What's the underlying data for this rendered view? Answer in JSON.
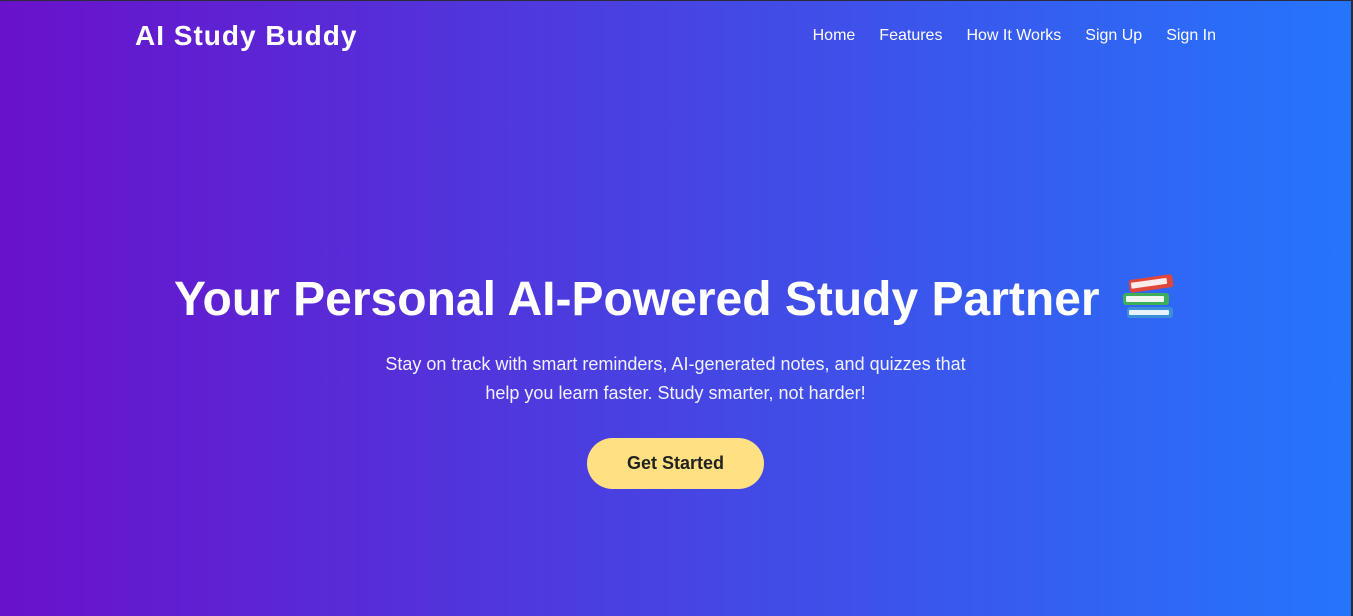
{
  "navbar": {
    "brand": "AI Study Buddy",
    "links": [
      {
        "label": "Home"
      },
      {
        "label": "Features"
      },
      {
        "label": "How It Works"
      },
      {
        "label": "Sign Up"
      },
      {
        "label": "Sign In"
      }
    ]
  },
  "hero": {
    "title": "Your Personal AI-Powered Study Partner",
    "title_icon": "books-icon",
    "subtitle": "Stay on track with smart reminders, AI-generated notes, and quizzes that help you learn faster. Study smarter, not harder!",
    "cta_label": "Get Started"
  },
  "colors": {
    "gradient_start": "#6a11cb",
    "gradient_end": "#2575fc",
    "cta_background": "#ffe082",
    "text": "#ffffff"
  }
}
